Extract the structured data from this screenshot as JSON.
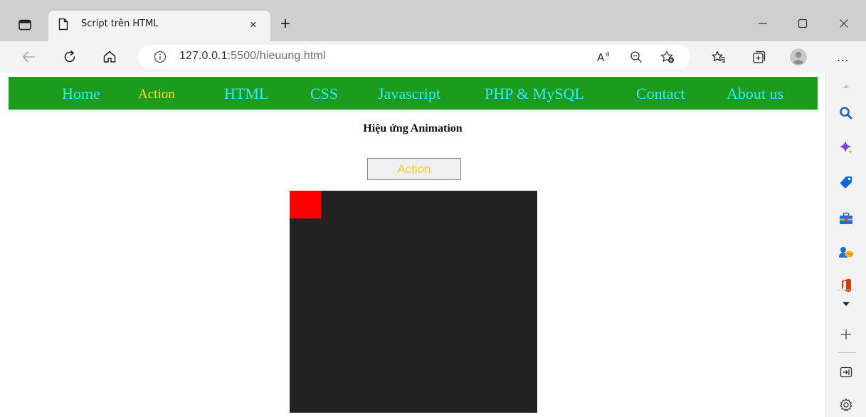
{
  "browser": {
    "tab_title": "Script trên HTML",
    "tab_close": "×",
    "new_tab": "+",
    "url_host": "127.0.0.1",
    "url_rest": ":5500/hieuung.html",
    "more_menu": "…"
  },
  "page": {
    "nav": [
      {
        "label": "Home",
        "active": false
      },
      {
        "label": "Action",
        "active": true
      },
      {
        "label": "HTML",
        "active": false
      },
      {
        "label": "CSS",
        "active": false
      },
      {
        "label": "Javascript",
        "active": false
      },
      {
        "label": "PHP & MySQL",
        "active": false
      },
      {
        "label": "Contact",
        "active": false
      },
      {
        "label": "About us",
        "active": false
      }
    ],
    "heading": "Hiệu ứng Animation",
    "action_button": "Action"
  },
  "colors": {
    "nav_bg": "#1d9b1d",
    "nav_text": "#36e8ff",
    "nav_active": "#ffe01a",
    "button_text": "#ffcc33",
    "container_bg": "#222222",
    "box": "#ff0000"
  },
  "icons": {
    "tab_actions": "tab-actions-icon",
    "page": "page-icon",
    "back": "back-arrow-icon",
    "refresh": "refresh-icon",
    "home": "home-icon",
    "info": "info-icon",
    "read_aloud": "read-aloud-icon",
    "zoom_out": "zoom-out-icon",
    "add_favorite": "add-favorite-icon",
    "favorites": "favorites-icon",
    "collections": "collections-icon",
    "profile": "profile-icon",
    "sidebar_search": "search-icon",
    "copilot": "copilot-icon",
    "shopping": "shopping-tag-icon",
    "tools": "toolbox-icon",
    "games": "games-icon",
    "office": "office-icon",
    "add": "plus-icon",
    "hide_sidebar": "sidebar-toggle-icon",
    "settings": "gear-icon"
  }
}
